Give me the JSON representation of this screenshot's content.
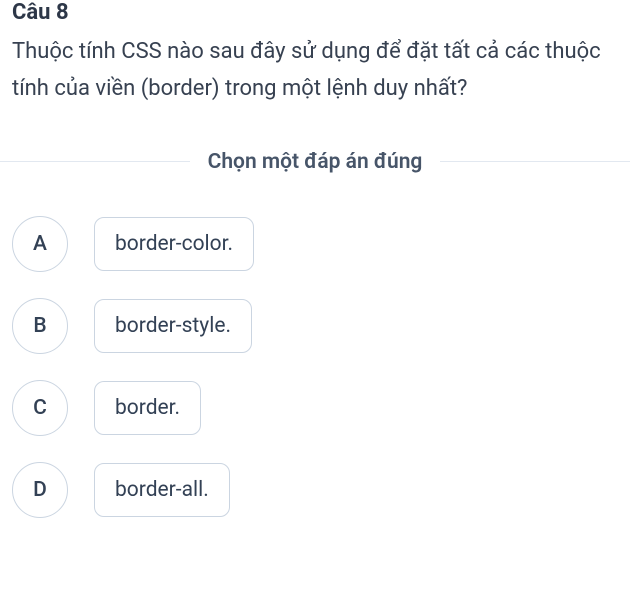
{
  "question": {
    "number": "Câu 8",
    "text": "Thuộc tính CSS nào sau đây sử dụng để đặt tất cả các thuộc tính của viền (border) trong một lệnh duy nhất?"
  },
  "instruction": "Chọn một đáp án đúng",
  "options": [
    {
      "letter": "A",
      "text": "border-color."
    },
    {
      "letter": "B",
      "text": "border-style."
    },
    {
      "letter": "C",
      "text": "border."
    },
    {
      "letter": "D",
      "text": "border-all."
    }
  ]
}
